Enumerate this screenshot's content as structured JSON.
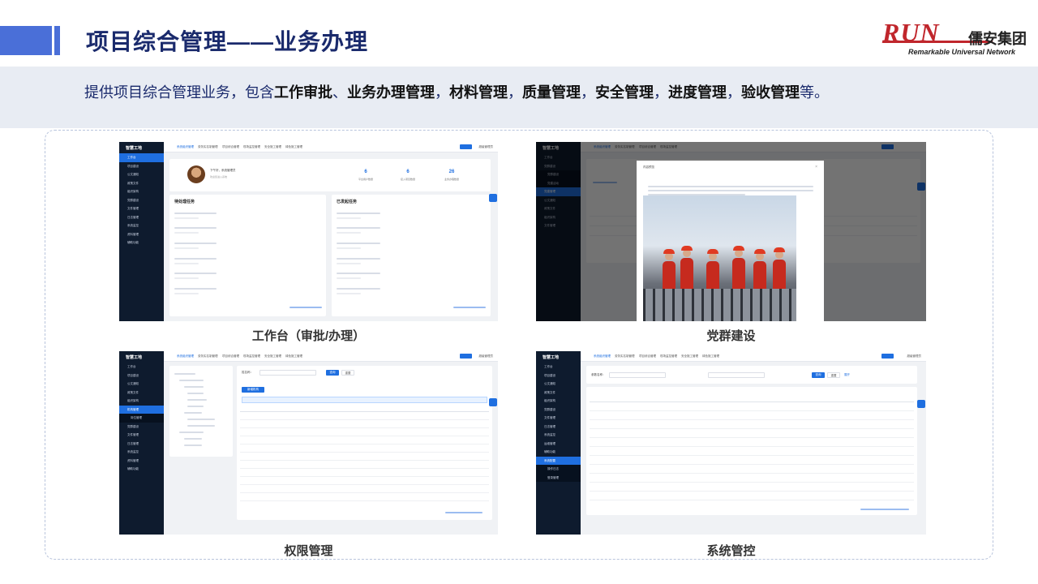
{
  "header": {
    "title": "项目综合管理——业务办理"
  },
  "logo": {
    "mark": "RUN",
    "name_cn": "儒安集团",
    "name_en": "Remarkable Universal Network"
  },
  "intro": {
    "prefix": "提供项目综合管理业务，包含",
    "items": [
      "工作审批",
      "业务办理管理",
      "材料管理",
      "质量管理",
      "安全管理",
      "进度管理",
      "验收管理"
    ],
    "separators": [
      "、",
      "，",
      "，",
      "，",
      "，",
      "，"
    ],
    "suffix": "等。"
  },
  "app": {
    "brand": "智慧工地",
    "tabs": [
      "系统组织管理",
      "劳务实名制管理",
      "项目综合管理",
      "现场监控管理",
      "安全施工管理",
      "绿色施工管理"
    ],
    "manager_label": "超级管理员"
  },
  "panels": [
    {
      "caption": "工作台（审批/办理）"
    },
    {
      "caption": "党群建设"
    },
    {
      "caption": "权限管理"
    },
    {
      "caption": "系统管控"
    }
  ],
  "workbench": {
    "greeting": "下午好，系统管理员",
    "stats": [
      {
        "value": "6",
        "label": "平台用户数量"
      },
      {
        "value": "6",
        "label": "接入项目数量"
      },
      {
        "value": "26",
        "label": "业务办理数量"
      }
    ],
    "todo_title": "待处理任务",
    "done_title": "已发起任务"
  },
  "party": {
    "modal_title": "内容预览"
  },
  "permission": {
    "search_label": "姓名称：",
    "query": "查询",
    "reset": "重置",
    "add": "新增机构"
  },
  "system": {
    "search_label": "参数名称：",
    "query": "查询",
    "reset": "重置",
    "more": "展开"
  }
}
